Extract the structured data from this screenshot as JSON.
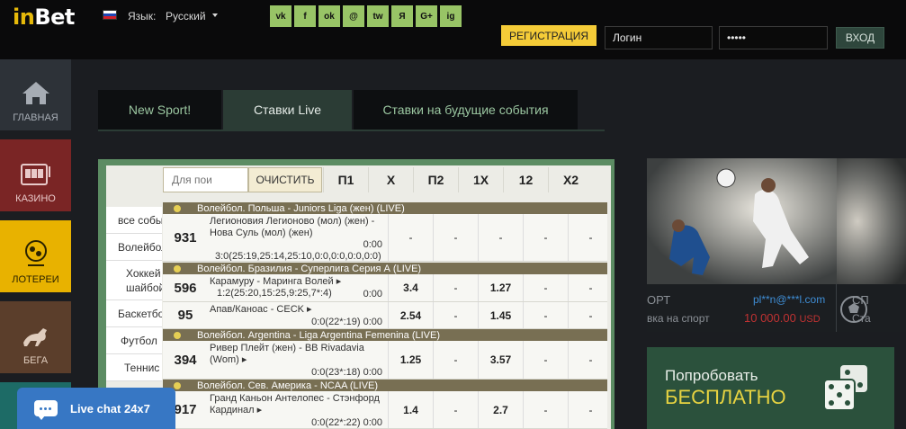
{
  "header": {
    "logo_in": "in",
    "logo_bet": "Bet",
    "language_label": "Язык:",
    "language_value": "Русский",
    "social": [
      "vk",
      "f",
      "ok",
      "@",
      "tw",
      "Я",
      "G+",
      "ig"
    ],
    "register_label": "РЕГИСТРАЦИЯ",
    "login_value": "Логин",
    "password_value": "•••••",
    "enter_label": "ВХОД"
  },
  "sidebar": {
    "home": "ГЛАВНАЯ",
    "casino": "КАЗИНО",
    "lottery": "ЛОТЕРЕИ",
    "race": "БЕГА"
  },
  "tabs": [
    "New Sport!",
    "Ставки Live",
    "Ставки на будущие события"
  ],
  "live": {
    "filter_placeholder": "Для пои",
    "clear_label": "ОЧИСТИТЬ",
    "columns": [
      "П1",
      "Х",
      "П2",
      "1Х",
      "12",
      "Х2"
    ],
    "sports": [
      "все собы",
      "Волейбол",
      "Хоккей",
      "шайбой",
      "Баскетбо",
      "Футбол",
      "Теннис"
    ],
    "leagues": [
      "Волейбол. Польша - Juniors Liga (жен) (LIVE)",
      "Волейбол. Бразилия - Суперлига Серия А (LIVE)",
      "Волейбол. Argentina - Liga Argentina Femenina (LIVE)",
      "Волейбол. Сев. Америка - NCAA (LIVE)"
    ],
    "matches": [
      {
        "num": "931",
        "team1": "Легионовия Легионово (мол) (жен) -",
        "team2": "Нова Суль (мол) (жен)",
        "time": "0:00",
        "score": "3:0(25:19,25:14,25:10,0:0,0:0,0:0,0:0)",
        "odds": [
          "-",
          "-",
          "-",
          "-",
          "-",
          "-"
        ]
      },
      {
        "num": "596",
        "team1": "Карамуру - Маринга Волей ▸",
        "team2": "",
        "time": "0:00",
        "score": "1:2(25:20,15:25,9:25,7*:4)",
        "odds": [
          "3.4",
          "-",
          "1.27",
          "-",
          "-",
          "-"
        ]
      },
      {
        "num": "95",
        "team1": "Апав/Каноас - CECK ▸",
        "team2": "",
        "time": "0:0(22*:19)  0:00",
        "score": "",
        "odds": [
          "2.54",
          "-",
          "1.45",
          "-",
          "-",
          "-"
        ]
      },
      {
        "num": "394",
        "team1": "Ривер Плейт (жен) - BB Rivadavia",
        "team2": "(Wom) ▸",
        "time": "0:0(23*:18)  0:00",
        "score": "",
        "odds": [
          "1.25",
          "-",
          "3.57",
          "-",
          "-",
          "-"
        ]
      },
      {
        "num": "917",
        "team1": "Гранд Каньон Антелопес - Стэнфорд",
        "team2": "Кардинал ▸",
        "time": "0:0(22*:22)  0:00",
        "score": "",
        "odds": [
          "1.4",
          "-",
          "2.7",
          "-",
          "-",
          "-"
        ]
      }
    ]
  },
  "chat": {
    "label": "Live chat 24x7"
  },
  "banner": {
    "title": "ОРТ",
    "subtitle": "вка на спорт",
    "email": "pl**n@***l.com",
    "amount": "10 000.00",
    "currency": "USD",
    "second_title": "СП",
    "second_sub": "Ста"
  },
  "promo": {
    "line1": "Попробовать",
    "line2": "БЕСПЛАТНО"
  },
  "colors": {
    "accent_green": "#2b513c",
    "gold": "#f5cc38",
    "live_chat": "#3777c4"
  }
}
